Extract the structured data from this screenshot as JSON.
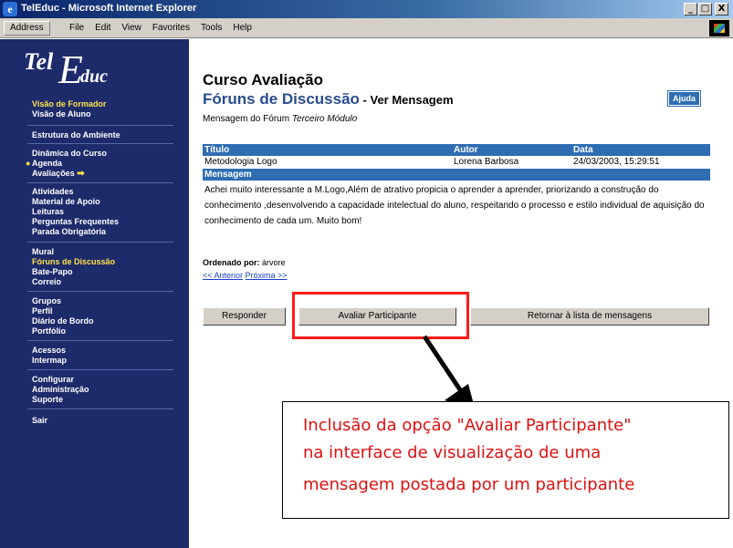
{
  "window": {
    "title": "TelEduc - Microsoft Internet Explorer",
    "minimize": "_",
    "maximize": "□",
    "close": "X"
  },
  "menubar": {
    "address": "Address",
    "items": [
      "File",
      "Edit",
      "View",
      "Favorites",
      "Tools",
      "Help"
    ]
  },
  "sidebar": {
    "brand": {
      "tel": "Tel",
      "e": "E",
      "rest": "duc"
    },
    "group1": [
      "Visão de Formador",
      "Visão de Aluno"
    ],
    "group2": [
      "Estrutura do Ambiente"
    ],
    "group3": [
      "Dinâmica do Curso",
      "Agenda",
      "Avaliações"
    ],
    "group4": [
      "Atividades",
      "Material de Apoio",
      "Leituras",
      "Perguntas Frequentes",
      "Parada Obrigatória"
    ],
    "group5": [
      "Mural",
      "Fóruns de Discussão",
      "Bate-Papo",
      "Correio"
    ],
    "group6": [
      "Grupos",
      "Perfil",
      "Diário de Bordo",
      "Portfólio"
    ],
    "group7": [
      "Acessos",
      "Intermap"
    ],
    "group8": [
      "Configurar",
      "Administração",
      "Suporte"
    ],
    "group9": [
      "Sair"
    ]
  },
  "main": {
    "course": "Curso Avaliação",
    "forum_title": "Fóruns de Discussão",
    "forum_sub": " - Ver Mensagem",
    "help": "Ajuda",
    "from_prefix": "Mensagem do Fórum ",
    "from_forum": "Terceiro Módulo",
    "table": {
      "headers": [
        "Título",
        "Autor",
        "Data"
      ],
      "row": [
        "Metodologia Logo",
        "Lorena Barbosa",
        "24/03/2003, 15:29:51"
      ],
      "message_label": "Mensagem",
      "message": "Achei muito interessante a M.Logo,Além de atrativo propicia o aprender a aprender, priorizando a construção do conhecimento ,desenvolvendo a capacidade intelectual do aluno, respeitando o processo e estilo individual de aquisição do conhecimento de cada um. Muito bom!"
    },
    "ordered_label": "Ordenado por:",
    "ordered_value": " árvore",
    "prev": "<< Anterior",
    "next": "Próxima >>",
    "buttons": {
      "reply": "Responder",
      "evaluate": "Avaliar Participante",
      "back": "Retornar à lista de mensagens"
    },
    "annotation": [
      "Inclusão da opção \"Avaliar Participante\"",
      "na interface de visualização de uma",
      "mensagem postada por um participante"
    ]
  },
  "colors": {
    "sidebar": "#1d2b6b",
    "header": "#2f6db3",
    "highlight": "#ffe24a",
    "annotation": "#e01010"
  }
}
